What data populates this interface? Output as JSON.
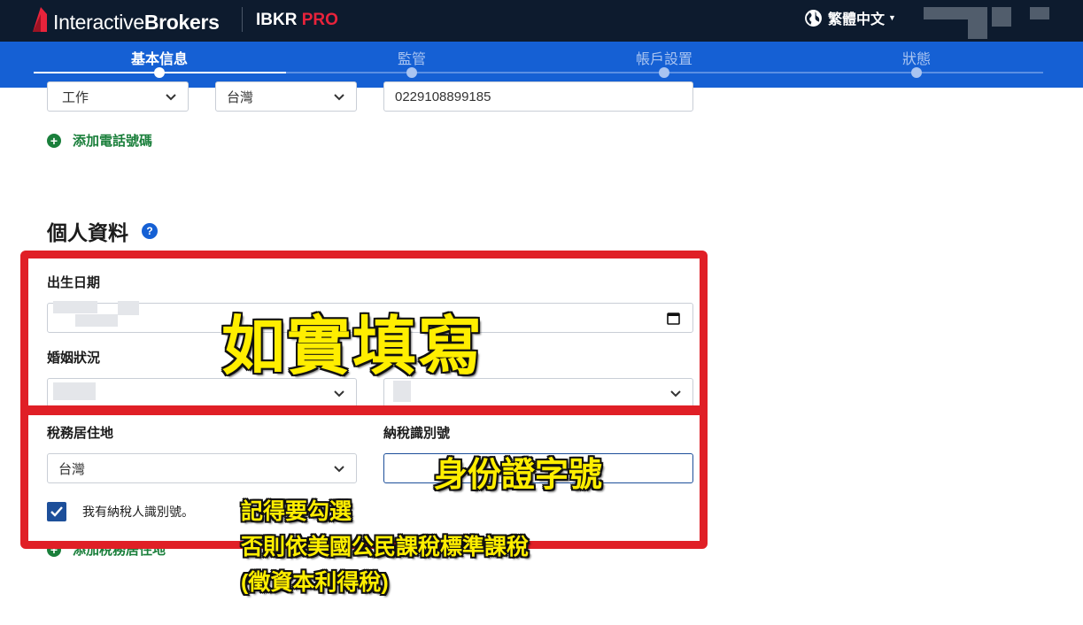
{
  "header": {
    "logo_light": "Interactive",
    "logo_bold": "Brokers",
    "product": "IBKR",
    "product_pro": "PRO",
    "language": "繁體中文"
  },
  "steps": [
    {
      "label": "基本信息",
      "active": true
    },
    {
      "label": "監管",
      "active": false
    },
    {
      "label": "帳戶設置",
      "active": false
    },
    {
      "label": "狀態",
      "active": false
    }
  ],
  "phone": {
    "type_value": "工作",
    "country_value": "台灣",
    "number_value": "0229108899185",
    "add_phone_label": "添加電話號碼"
  },
  "personal": {
    "section_title": "個人資料",
    "help_label": "?",
    "dob_label": "出生日期",
    "marital_label": "婚姻狀況",
    "tax_residence_label": "稅務居住地",
    "tax_residence_value": "台灣",
    "tin_label": "納稅識別號",
    "tin_checkbox_label": "我有納稅人識別號。",
    "add_tax_residence_label": "添加稅務居住地"
  },
  "annotations": {
    "fill_truthfully": "如實填寫",
    "id_number": "身份證字號",
    "remember_check": "記得要勾選",
    "otherwise_taxed": "否則依美國公民課稅標準課稅",
    "withholding": "(徵資本利得稅)"
  },
  "colors": {
    "topbar": "#0d1b2e",
    "stepbar": "#1560d4",
    "accent_red": "#e8233b",
    "link_green": "#1a7f3b",
    "annotation_red": "#e01f26",
    "annotation_yellow": "#ffee00"
  }
}
